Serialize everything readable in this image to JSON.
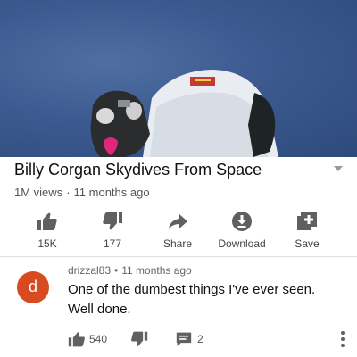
{
  "video": {
    "title": "Billy Corgan Skydives From Space",
    "views": "1M views",
    "age": "11 months ago",
    "separator": "·"
  },
  "actions": [
    {
      "icon": "thumbs-up-icon",
      "label": "15K"
    },
    {
      "icon": "thumbs-down-icon",
      "label": "177"
    },
    {
      "icon": "share-icon",
      "label": "Share"
    },
    {
      "icon": "download-icon",
      "label": "Download"
    },
    {
      "icon": "save-to-playlist-icon",
      "label": "Save"
    }
  ],
  "comment": {
    "avatar_letter": "d",
    "avatar_color": "#d84a20",
    "author": "drizzal83",
    "separator": "•",
    "age": "11 months ago",
    "text": "One of the dumbest things I've ever seen. Well done.",
    "likes": "540",
    "replies": "2"
  }
}
